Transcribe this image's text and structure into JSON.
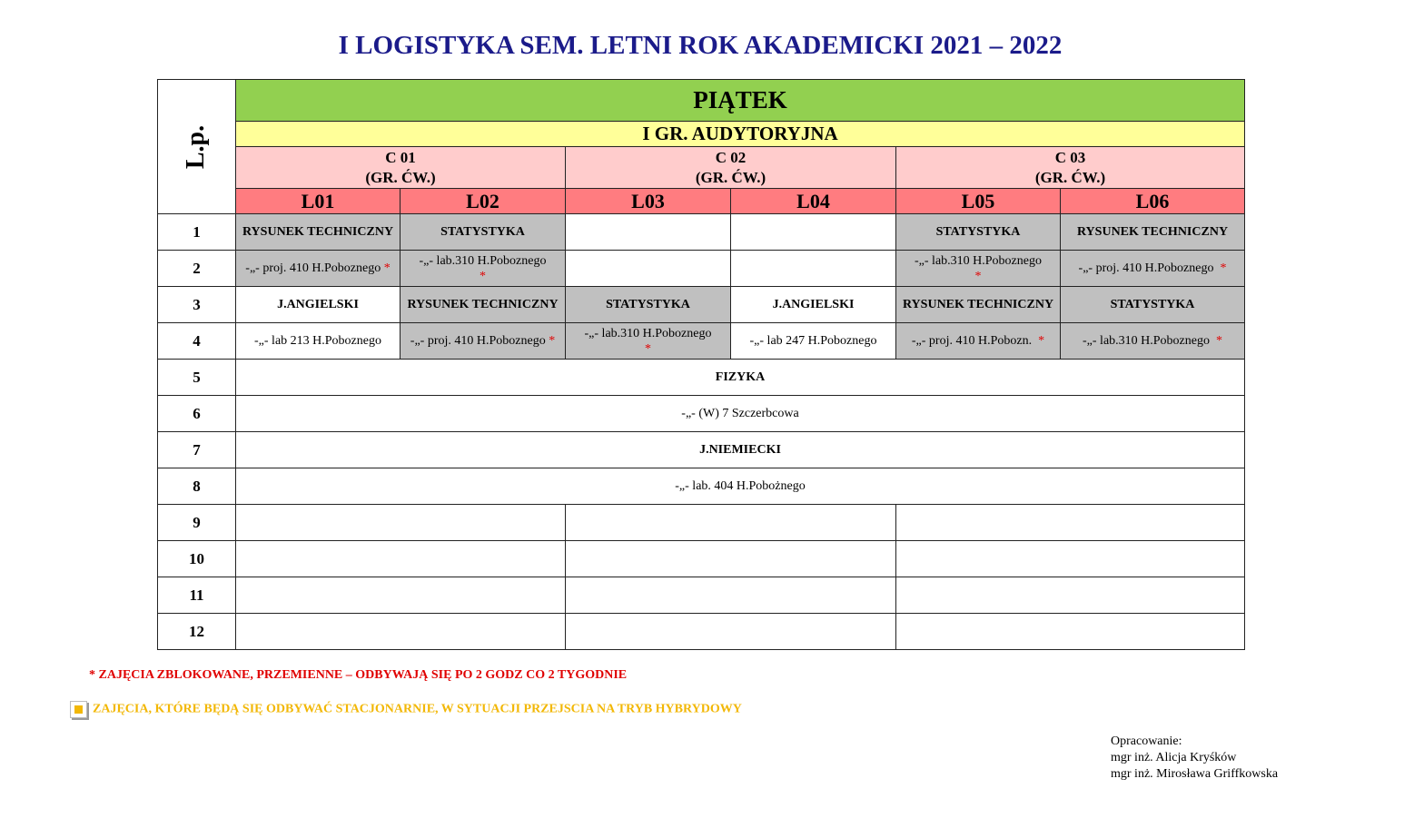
{
  "title": "I LOGISTYKA SEM. LETNI ROK AKADEMICKI 2021 – 2022",
  "header": {
    "lp": "L.p.",
    "day": "PIĄTEK",
    "group": "I GR. AUDYTORYJNA",
    "cw_groups": [
      {
        "code": "C 01",
        "sub": "(GR. ĆW.)"
      },
      {
        "code": "C 02",
        "sub": "(GR. ĆW.)"
      },
      {
        "code": "C 03",
        "sub": "(GR. ĆW.)"
      }
    ],
    "labs": [
      "L01",
      "L02",
      "L03",
      "L04",
      "L05",
      "L06"
    ]
  },
  "rows": {
    "r1": {
      "n": "1",
      "l01": "RYSUNEK TECHNICZNY",
      "l02": "STATYSTYKA",
      "l05": "STATYSTYKA",
      "l06": "RYSUNEK TECHNICZNY"
    },
    "r2": {
      "n": "2",
      "l01": "-„- proj. 410 H.Poboznego",
      "l02": "-„- lab.310 H.Poboznego",
      "l05": "-„- lab.310 H.Poboznego",
      "l06": "-„- proj. 410 H.Poboznego"
    },
    "r3": {
      "n": "3",
      "l01": "J.ANGIELSKI",
      "l02": "RYSUNEK TECHNICZNY",
      "l03": "STATYSTYKA",
      "l04": "J.ANGIELSKI",
      "l05": "RYSUNEK TECHNICZNY",
      "l06": "STATYSTYKA"
    },
    "r4": {
      "n": "4",
      "l01": "-„- lab 213 H.Poboznego",
      "l02": "-„- proj.  410 H.Poboznego",
      "l03": "-„- lab.310 H.Poboznego",
      "l04": "-„- lab 247 H.Poboznego",
      "l05": "-„- proj. 410 H.Pobozn.",
      "l06": "-„- lab.310 H.Poboznego"
    },
    "r5": {
      "n": "5",
      "all": "FIZYKA"
    },
    "r6": {
      "n": "6",
      "all": "-„- (W)  7 Szczerbcowa"
    },
    "r7": {
      "n": "7",
      "all": "J.NIEMIECKI"
    },
    "r8": {
      "n": "8",
      "all": "-„- lab. 404 H.Pobożnego"
    },
    "r9": {
      "n": "9"
    },
    "r10": {
      "n": "10"
    },
    "r11": {
      "n": "11"
    },
    "r12": {
      "n": "12"
    }
  },
  "asterisk": "*",
  "notes": {
    "blocked": "* ZAJĘCIA ZBLOKOWANE, PRZEMIENNE – ODBYWAJĄ SIĘ PO 2 GODZ CO 2 TYGODNIE",
    "stationary": "ZAJĘCIA, KTÓRE BĘDĄ SIĘ ODBYWAĆ STACJONARNIE, W SYTUACJI PRZEJSCIA NA TRYB HYBRYDOWY"
  },
  "author": {
    "label": "Opracowanie:",
    "name1": "mgr inż. Alicja Kryśków",
    "name2": "mgr inż. Mirosława Griffkowska"
  },
  "colors": {
    "title": "#1b1b8a",
    "day": "#92d050",
    "group": "#ffff99",
    "cw": "#ffcccc",
    "lab": "#ff7c80",
    "blocked_class": "#c0c0c0",
    "note_red": "#e00000",
    "note_yellow": "#f2b705"
  },
  "legend_icon": "yellow-square-icon"
}
